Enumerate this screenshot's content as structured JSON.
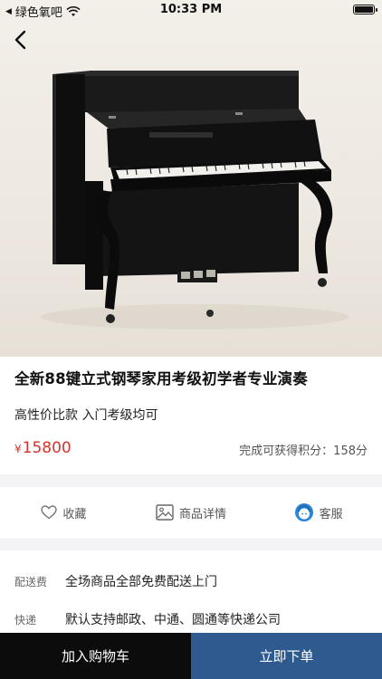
{
  "status_bar": {
    "carrier": "绿色氧吧",
    "time": "10:33 PM"
  },
  "product": {
    "title": "全新88键立式钢琴家用考级初学者专业演奏",
    "subtitle": "高性价比款 入门考级均可",
    "price_symbol": "¥",
    "price": "15800",
    "points_text": "完成可获得积分：158分"
  },
  "actions": {
    "favorite": "收藏",
    "details": "商品详情",
    "service": "客服"
  },
  "info": {
    "shipping_label": "配送费",
    "shipping_value": "全场商品全部免费配送上门",
    "express_label": "快递",
    "express_value": "默认支持邮政、中通、圆通等快递公司"
  },
  "bottom": {
    "add_to_cart": "加入购物车",
    "buy_now": "立即下单"
  },
  "colors": {
    "price": "#d8322c",
    "buy_button": "#2f5a8f",
    "cart_button": "#0c0c0c",
    "service_icon": "#2b86d9"
  },
  "icons": {
    "back": "chevron-left-icon",
    "favorite": "heart-icon",
    "details": "image-icon",
    "service": "customer-service-icon"
  }
}
